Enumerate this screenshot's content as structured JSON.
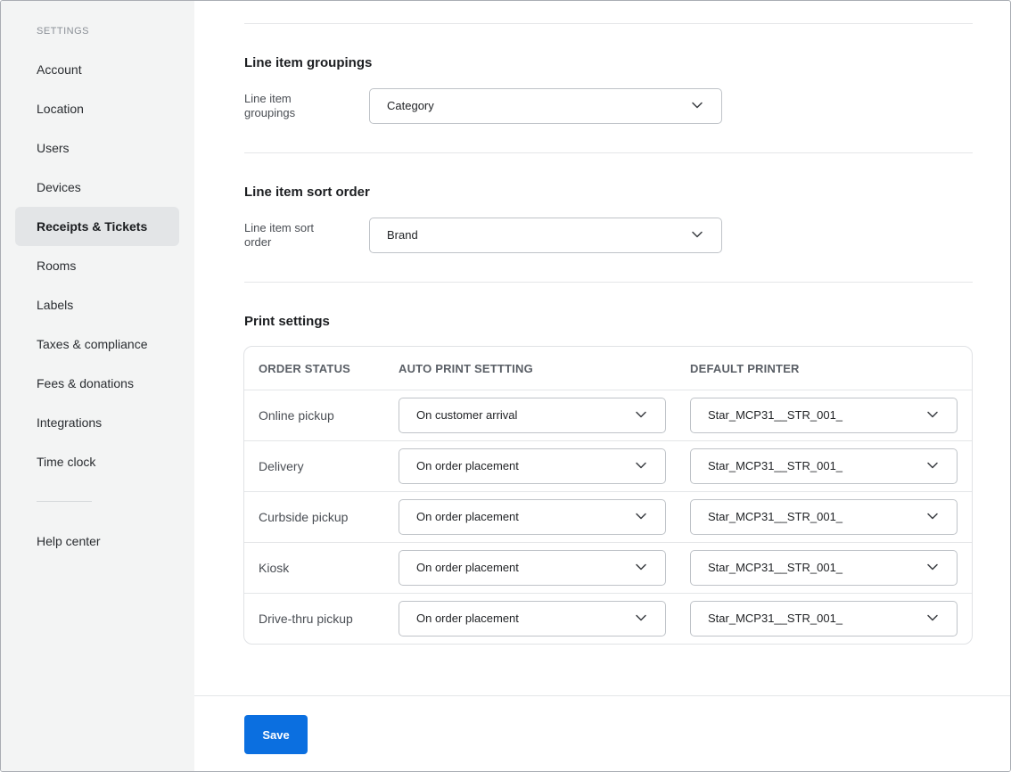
{
  "sidebar": {
    "heading": "SETTINGS",
    "items": [
      {
        "label": "Account"
      },
      {
        "label": "Location"
      },
      {
        "label": "Users"
      },
      {
        "label": "Devices"
      },
      {
        "label": "Receipts & Tickets",
        "active": true
      },
      {
        "label": "Rooms"
      },
      {
        "label": "Labels"
      },
      {
        "label": "Taxes & compliance"
      },
      {
        "label": "Fees & donations"
      },
      {
        "label": "Integrations"
      },
      {
        "label": "Time clock"
      }
    ],
    "help": "Help center"
  },
  "groupings": {
    "title": "Line item groupings",
    "label": "Line item groupings",
    "value": "Category"
  },
  "sort": {
    "title": "Line item sort order",
    "label": "Line item sort order",
    "value": "Brand"
  },
  "print": {
    "title": "Print settings",
    "columns": [
      "ORDER STATUS",
      "AUTO PRINT SETTTING",
      "DEFAULT PRINTER"
    ],
    "rows": [
      {
        "status": "Online pickup",
        "auto": "On customer arrival",
        "printer": "Star_MCP31__STR_001_"
      },
      {
        "status": "Delivery",
        "auto": "On order placement",
        "printer": "Star_MCP31__STR_001_"
      },
      {
        "status": "Curbside pickup",
        "auto": "On order placement",
        "printer": "Star_MCP31__STR_001_"
      },
      {
        "status": "Kiosk",
        "auto": "On order placement",
        "printer": "Star_MCP31__STR_001_"
      },
      {
        "status": "Drive-thru pickup",
        "auto": "On order placement",
        "printer": "Star_MCP31__STR_001_"
      }
    ]
  },
  "footer": {
    "save_label": "Save"
  },
  "colors": {
    "accent": "#0b6fe0",
    "sidebar_bg": "#f3f4f4",
    "active_bg": "#e3e5e7"
  },
  "icons": {
    "select_chevron": "chevron-down-icon"
  }
}
